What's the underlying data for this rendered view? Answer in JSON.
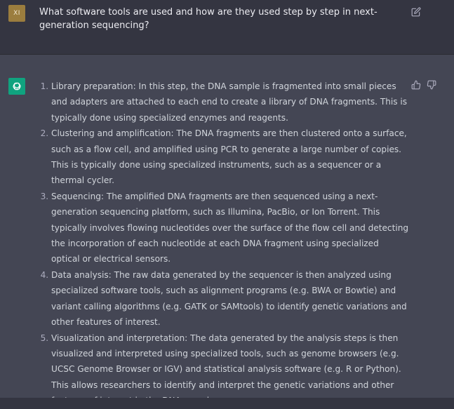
{
  "user": {
    "avatar_initials": "XI",
    "question": "What software tools are used and how are they used step by step in next-generation sequencing?"
  },
  "icons": {
    "edit": "edit-icon",
    "thumbs_up": "thumbs-up-icon",
    "thumbs_down": "thumbs-down-icon",
    "assistant_logo": "openai-logo-icon"
  },
  "colors": {
    "background": "#343541",
    "assistant_background": "#444654",
    "user_avatar": "#9b7d3e",
    "assistant_avatar": "#10a37f"
  },
  "answer": {
    "steps": [
      "Library preparation: In this step, the DNA sample is fragmented into small pieces and adapters are attached to each end to create a library of DNA fragments. This is typically done using specialized enzymes and reagents.",
      "Clustering and amplification: The DNA fragments are then clustered onto a surface, such as a flow cell, and amplified using PCR to generate a large number of copies. This is typically done using specialized instruments, such as a sequencer or a thermal cycler.",
      "Sequencing: The amplified DNA fragments are then sequenced using a next-generation sequencing platform, such as Illumina, PacBio, or Ion Torrent. This typically involves flowing nucleotides over the surface of the flow cell and detecting the incorporation of each nucleotide at each DNA fragment using specialized optical or electrical sensors.",
      "Data analysis: The raw data generated by the sequencer is then analyzed using specialized software tools, such as alignment programs (e.g. BWA or Bowtie) and variant calling algorithms (e.g. GATK or SAMtools) to identify genetic variations and other features of interest.",
      "Visualization and interpretation: The data generated by the analysis steps is then visualized and interpreted using specialized tools, such as genome browsers (e.g. UCSC Genome Browser or IGV) and statistical analysis software (e.g. R or Python). This allows researchers to identify and interpret the genetic variations and other features of interest in the DNA sample."
    ]
  }
}
